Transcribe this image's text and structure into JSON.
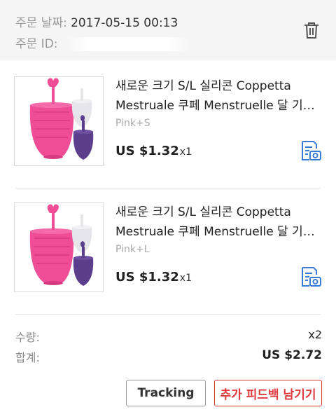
{
  "header": {
    "date_label": "주문 날짜:",
    "date_value": "2017-05-15 00:13",
    "id_label": "주문 ID:"
  },
  "items": [
    {
      "title": "새로운 크기 S/L 실리콘 Coppetta Mestruale 쿠페 Menstruelle 달 기간...",
      "variant": "Pink+S",
      "price": "US $1.32",
      "qty": "x1"
    },
    {
      "title": "새로운 크기 S/L 실리콘 Coppetta Mestruale 쿠페 Menstruelle 달 기간...",
      "variant": "Pink+L",
      "price": "US $1.32",
      "qty": "x1"
    }
  ],
  "summary": {
    "qty_label": "수량:",
    "qty_value": "x2",
    "total_label": "합계:",
    "total_value": "US $2.72"
  },
  "actions": {
    "tracking_label": "Tracking",
    "feedback_label": "추가 피드백 남기기"
  },
  "colors": {
    "accent_red": "#e0393e",
    "icon_blue": "#3a7bd5",
    "cup_pink": "#ef4d95",
    "cup_purple": "#5b3f8c"
  },
  "icons": {
    "delete": "trash-icon",
    "review": "photo-review-icon"
  }
}
